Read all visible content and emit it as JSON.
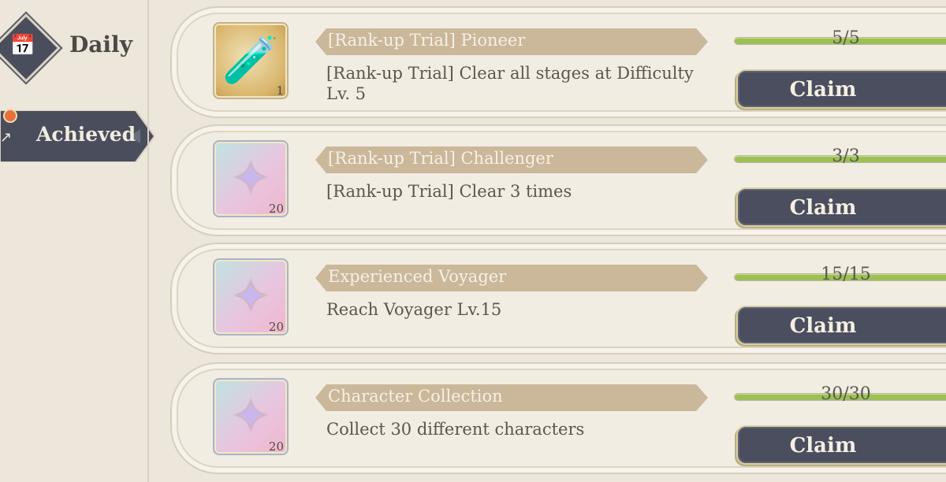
{
  "sidebar": {
    "daily_label": "Daily",
    "achieved_label": "Achieved",
    "daily_icon": "calendar-icon",
    "colors": {
      "tab_dark": "#4a4d5c",
      "notif": "#e8703a"
    }
  },
  "missions": [
    {
      "title": "[Rank-up Trial] Pioneer",
      "description": "[Rank-up Trial] Clear all stages at Difficulty Lv. 5",
      "reward_icon": "potion-icon",
      "reward_count": "1",
      "progress_text": "5/5",
      "progress": 1.0,
      "claim_label": "Claim"
    },
    {
      "title": "[Rank-up Trial] Challenger",
      "description": "[Rank-up Trial] Clear 3 times",
      "reward_icon": "star-crystal-icon",
      "reward_count": "20",
      "progress_text": "3/3",
      "progress": 1.0,
      "claim_label": "Claim"
    },
    {
      "title": "Experienced Voyager",
      "description": "Reach Voyager Lv.15",
      "reward_icon": "star-crystal-icon",
      "reward_count": "20",
      "progress_text": "15/15",
      "progress": 1.0,
      "claim_label": "Claim"
    },
    {
      "title": "Character Collection",
      "description": "Collect 30 different characters",
      "reward_icon": "star-crystal-icon",
      "reward_count": "20",
      "progress_text": "30/30",
      "progress": 1.0,
      "claim_label": "Claim"
    }
  ],
  "colors": {
    "background": "#ece7da",
    "banner": "#cbb79a",
    "progress_fill": "#9cc056",
    "claim_button": "#4b4e5f"
  }
}
